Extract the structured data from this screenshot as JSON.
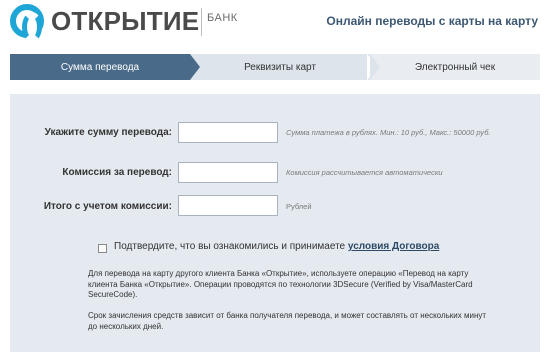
{
  "header": {
    "logo_text": "ОТКРЫТИЕ",
    "logo_sub": "БАНК",
    "page_title": "Онлайн переводы с карты на карту"
  },
  "steps": [
    {
      "label": "Сумма перевода",
      "active": true
    },
    {
      "label": "Реквизиты карт",
      "active": false
    },
    {
      "label": "Электронный чек",
      "active": false
    }
  ],
  "form": {
    "amount": {
      "label": "Укажите сумму перевода:",
      "value": "",
      "hint": "Сумма платежа в рублях. Мин.: 10 руб., Макс.: 50000 руб."
    },
    "commission": {
      "label": "Комиссия за перевод:",
      "value": "",
      "hint": "Комиссия рассчитывается автоматически"
    },
    "total": {
      "label": "Итого с учетом комиссии:",
      "value": "",
      "hint": "Рублей"
    },
    "confirm": {
      "text": "Подтвердите, что вы ознакомились и принимаете",
      "link": "условия Договора",
      "checked": false
    }
  },
  "info": {
    "paragraph1": "Для перевода на карту другого клиента Банка «Открытие», используете операцию «Перевод на карту клиента Банка «Открытие». Операции проводятся по технологии 3DSecure (Verified by Visa/MasterCard SecureCode).",
    "paragraph2": "Срок зачисления средств зависит от банка получателя перевода, и может составлять от нескольких минут до нескольких дней."
  },
  "colors": {
    "brand": "#1ea6d6",
    "active_step": "#4a6a8a",
    "panel": "#e5eaf0"
  }
}
